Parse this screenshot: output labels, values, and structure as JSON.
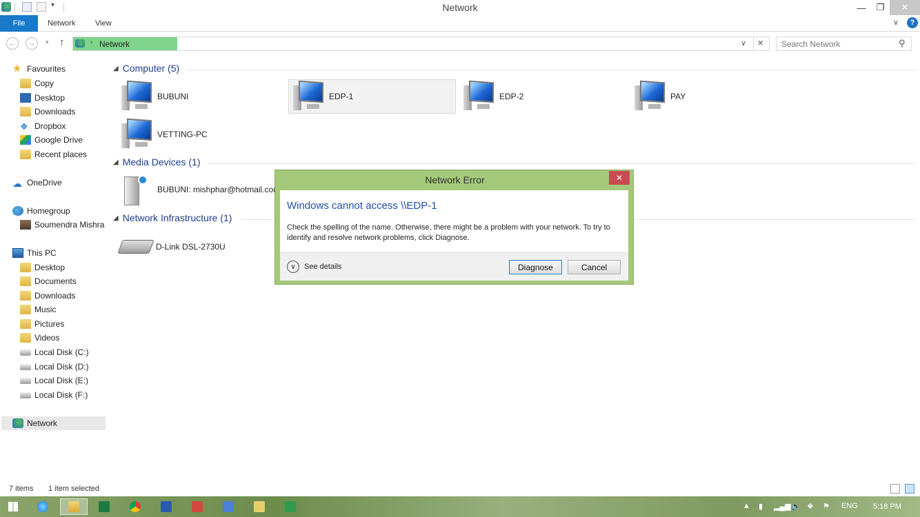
{
  "window": {
    "title": "Network",
    "controls": {
      "minimize": "—",
      "restore": "❐",
      "close": "✕"
    }
  },
  "ribbon": {
    "tabs": [
      "File",
      "Network",
      "View"
    ],
    "expand_icon": "chevron-down-icon",
    "help_icon": "help-icon"
  },
  "address": {
    "path": "Network",
    "progress": 0.15
  },
  "search": {
    "placeholder": "Search Network"
  },
  "nav": {
    "favourites": {
      "label": "Favourites",
      "items": [
        "Copy",
        "Desktop",
        "Downloads",
        "Dropbox",
        "Google Drive",
        "Recent places"
      ]
    },
    "onedrive": "OneDrive",
    "homegroup": {
      "label": "Homegroup",
      "items": [
        "Soumendra Mishra"
      ]
    },
    "thispc": {
      "label": "This PC",
      "items": [
        "Desktop",
        "Documents",
        "Downloads",
        "Music",
        "Pictures",
        "Videos",
        "Local Disk (C:)",
        "Local Disk (D:)",
        "Local Disk (E:)",
        "Local Disk (F:)"
      ]
    },
    "network": "Network"
  },
  "content": {
    "groups": [
      {
        "header": "Computer (5)",
        "items": [
          "BUBUNI",
          "EDP-1",
          "EDP-2",
          "PAY",
          "VETTING-PC"
        ]
      },
      {
        "header": "Media Devices (1)",
        "items": [
          "BUBUNI: mishphar@hotmail.com"
        ]
      },
      {
        "header": "Network Infrastructure (1)",
        "items": [
          "D-Link DSL-2730U"
        ]
      }
    ]
  },
  "dialog": {
    "title": "Network Error",
    "heading": "Windows cannot access \\\\EDP-1",
    "message": "Check the spelling of the name. Otherwise, there might be a problem with your network. To try to identify and resolve network problems, click Diagnose.",
    "see_details": "See details",
    "buttons": {
      "diagnose": "Diagnose",
      "cancel": "Cancel"
    },
    "close": "✕"
  },
  "status": {
    "count": "7 items",
    "selection": "1 item selected"
  },
  "taskbar": {
    "tray": {
      "language": "ENG",
      "time": "5:18 PM"
    }
  },
  "colors": {
    "accent": "#1979ca",
    "dialog_frame": "#a5c97b",
    "dialog_close": "#c74b50",
    "group_header": "#1e3d8b"
  }
}
